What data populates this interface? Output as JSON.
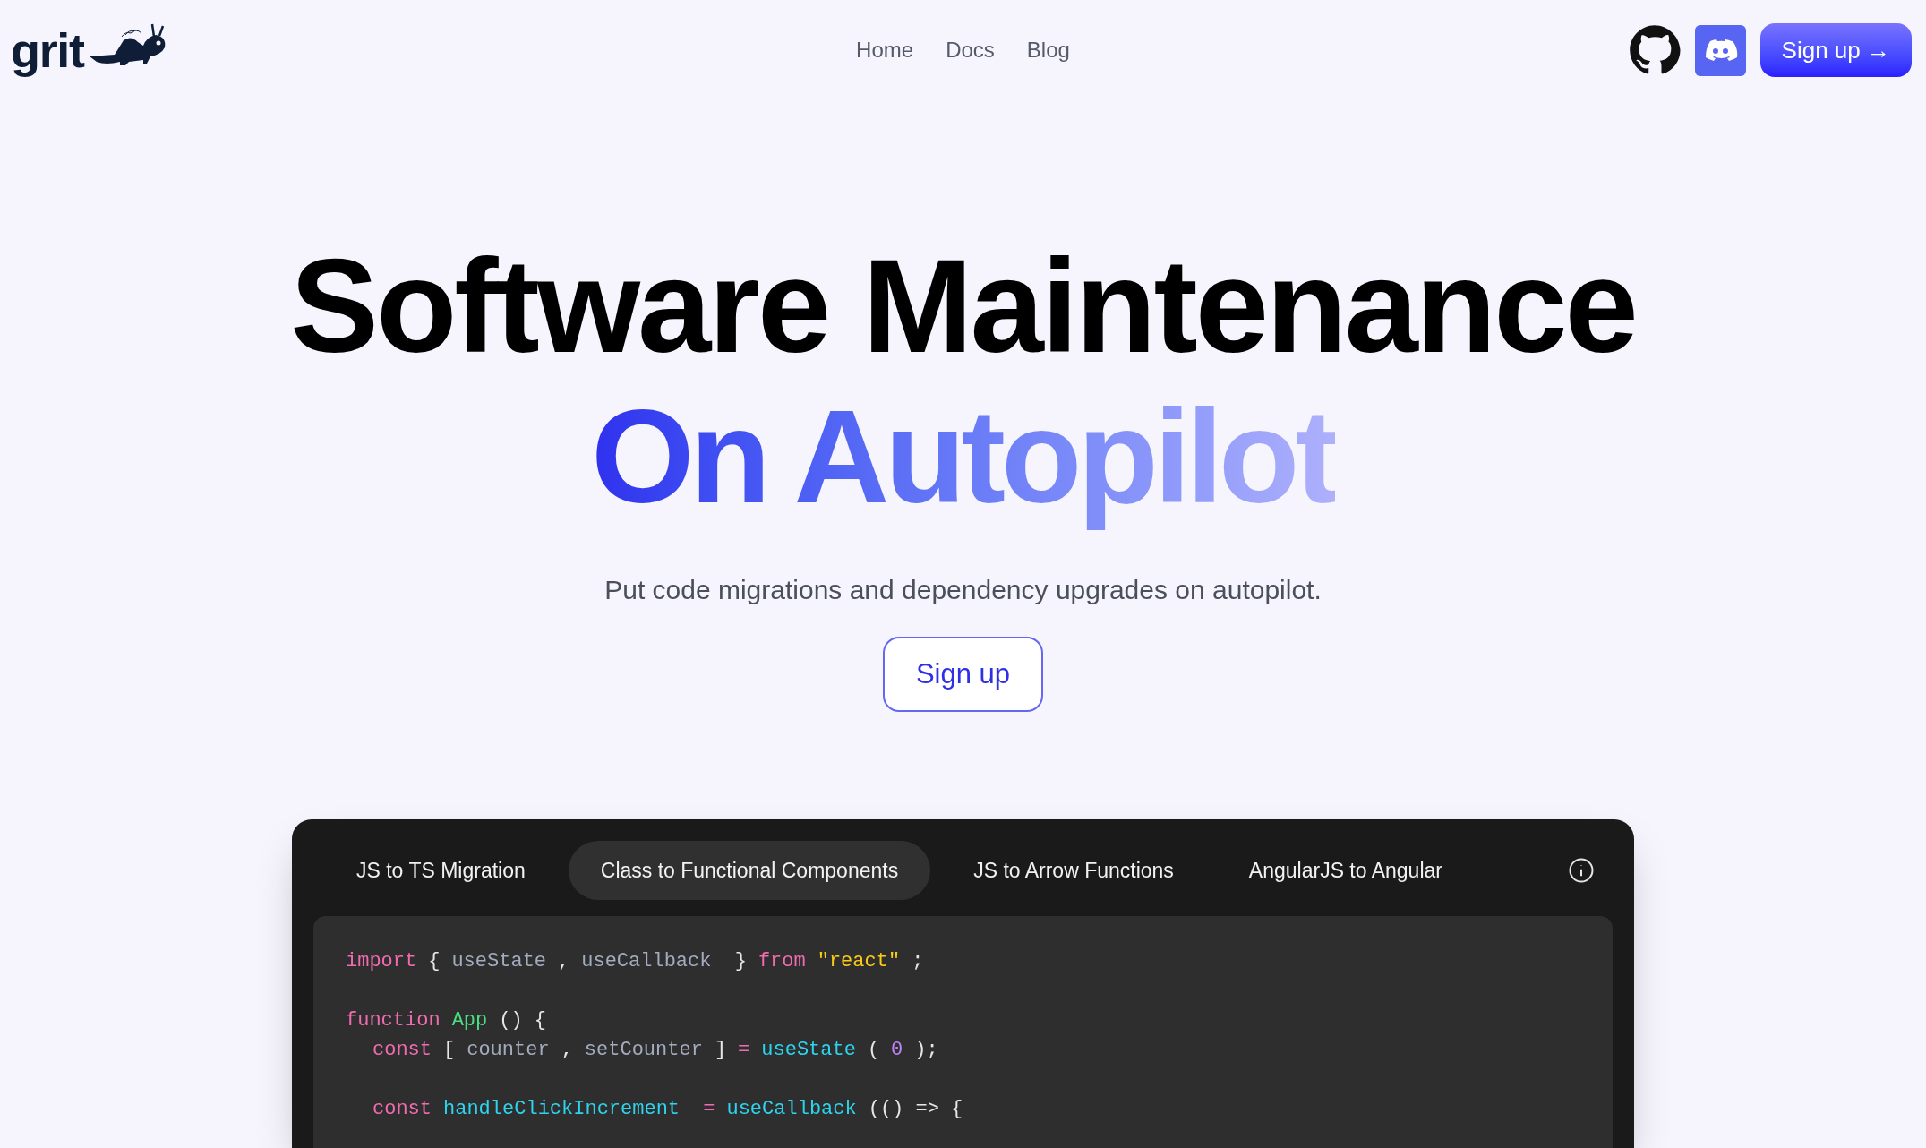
{
  "header": {
    "logo": "grit",
    "nav": [
      "Home",
      "Docs",
      "Blog"
    ],
    "signup": "Sign up →"
  },
  "hero": {
    "title": "Software Maintenance",
    "title_accent": "On Autopilot",
    "subtitle": "Put code migrations and dependency upgrades on autopilot.",
    "cta": "Sign up"
  },
  "demo": {
    "tabs": [
      {
        "label": "JS to TS Migration",
        "selected": false
      },
      {
        "label": "Class to Functional Components",
        "selected": true
      },
      {
        "label": "JS to Arrow Functions",
        "selected": false
      },
      {
        "label": "AngularJS to Angular",
        "selected": false
      }
    ],
    "code_blocks": [
      {
        "lines": [
          {
            "indented": false,
            "tokens": [
              {
                "kind": "keyword",
                "text": "import"
              },
              {
                "kind": "punct",
                "text": "{"
              },
              {
                "kind": "var",
                "text": "useState"
              },
              {
                "kind": "punct",
                "text": ","
              },
              {
                "kind": "var",
                "text": "useCallback"
              },
              {
                "kind": "punct",
                "text": " }"
              },
              {
                "kind": "keyword",
                "text": "from"
              },
              {
                "kind": "string",
                "text": "\"react\""
              },
              {
                "kind": "punct",
                "text": ";"
              }
            ]
          }
        ]
      },
      {
        "lines": [
          {
            "indented": false,
            "tokens": [
              {
                "kind": "keyword",
                "text": "function"
              },
              {
                "kind": "component",
                "text": "App"
              },
              {
                "kind": "punct",
                "text": "() {"
              }
            ]
          },
          {
            "indented": true,
            "tokens": [
              {
                "kind": "keyword",
                "text": "const"
              },
              {
                "kind": "punct",
                "text": "["
              },
              {
                "kind": "var",
                "text": "counter"
              },
              {
                "kind": "punct",
                "text": ","
              },
              {
                "kind": "var",
                "text": "setCounter"
              },
              {
                "kind": "punct",
                "text": "]"
              },
              {
                "kind": "keyword",
                "text": "="
              },
              {
                "kind": "func",
                "text": "useState"
              },
              {
                "kind": "punct",
                "text": "("
              },
              {
                "kind": "number",
                "text": "0"
              },
              {
                "kind": "punct",
                "text": ");"
              }
            ]
          }
        ]
      },
      {
        "lines": [
          {
            "indented": true,
            "tokens": [
              {
                "kind": "keyword",
                "text": "const"
              },
              {
                "kind": "func",
                "text": "handleClickIncrement"
              },
              {
                "kind": "keyword",
                "text": " ="
              },
              {
                "kind": "func",
                "text": "useCallback"
              },
              {
                "kind": "punct",
                "text": "(() => {"
              }
            ]
          }
        ]
      }
    ]
  }
}
